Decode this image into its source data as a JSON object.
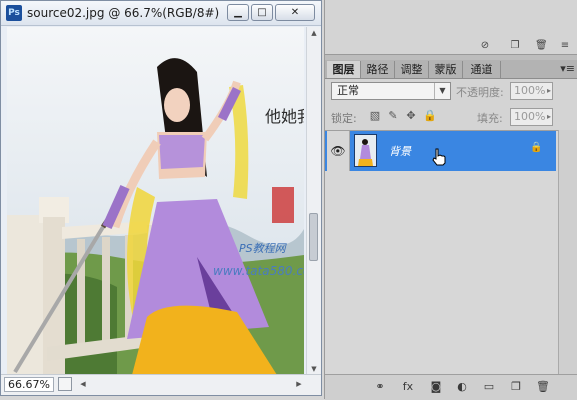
{
  "window": {
    "title": "source02.jpg @ 66.7%(RGB/8#)",
    "app_icon": "Ps",
    "min_glyph": "▁",
    "max_glyph": "□",
    "close_glyph": "✕"
  },
  "canvas": {
    "watermark_site": "www.tata580.com",
    "watermark_brand": "PS教程网",
    "calligraphy": "他她我等你"
  },
  "status": {
    "zoom": "66.67%"
  },
  "panel": {
    "tabs": [
      {
        "label": "图层",
        "active": true
      },
      {
        "label": "路径",
        "active": false
      },
      {
        "label": "调整",
        "active": false
      },
      {
        "label": "蒙版",
        "active": false
      },
      {
        "label": "通道",
        "active": false
      }
    ],
    "blend_mode": "正常",
    "opacity_label": "不透明度:",
    "opacity_value": "100%",
    "lock_label": "锁定:",
    "fill_label": "填充:",
    "fill_value": "100%",
    "layers": [
      {
        "name": "背景",
        "selected": true,
        "visible": true,
        "locked": true
      }
    ]
  },
  "colors": {
    "selection": "#3a86e2",
    "panel_bg": "#d4d4d4"
  }
}
